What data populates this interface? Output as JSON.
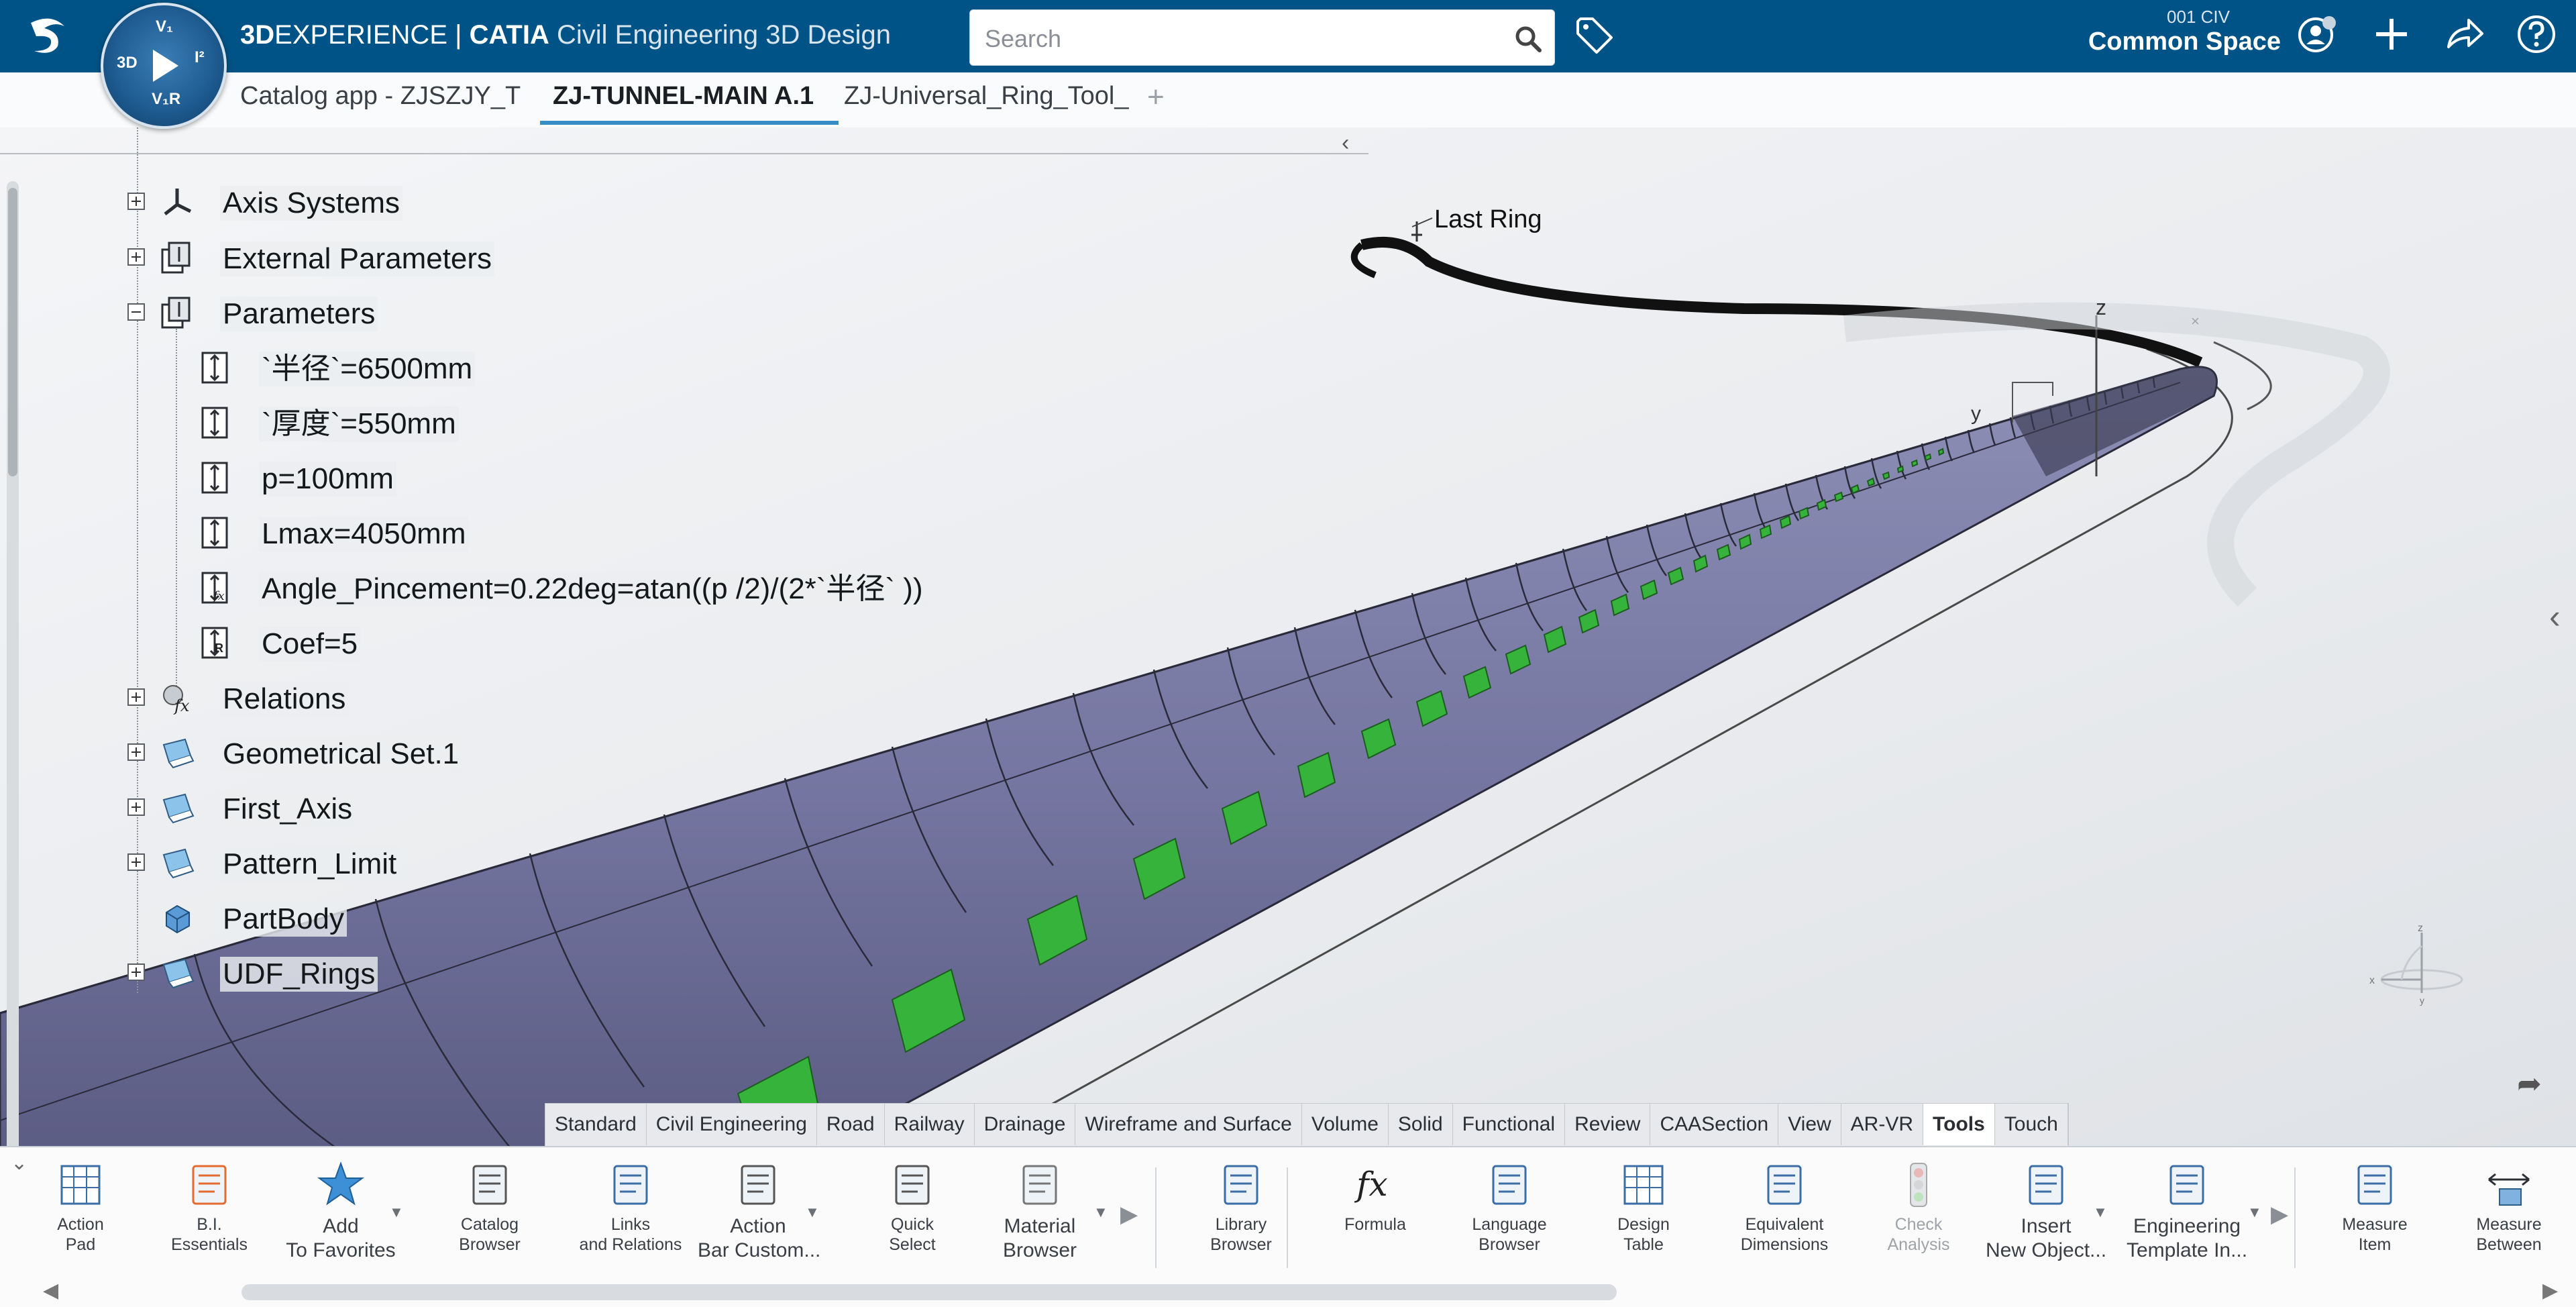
{
  "header": {
    "brand_3d": "3D",
    "brand_experience": "EXPERIENCE",
    "brand_separator": " | ",
    "brand_catia": "CATIA",
    "brand_app": " Civil Engineering 3D Design",
    "search_placeholder": "Search",
    "space_code": "001 CIV",
    "space_name": "Common Space",
    "compass_top": "V₁",
    "compass_left": "3D",
    "compass_right": "I²",
    "compass_bottom": "V₁R"
  },
  "tabs": [
    {
      "label": "Catalog app - ZJSZJY_T",
      "active": false
    },
    {
      "label": "ZJ-TUNNEL-MAIN A.1",
      "active": true
    },
    {
      "label": "ZJ-Universal_Ring_Tool_",
      "active": false
    }
  ],
  "tree": {
    "items": [
      {
        "label": "Axis Systems",
        "expand": "plus",
        "icon": "axis-system-icon"
      },
      {
        "label": "External Parameters",
        "expand": "plus",
        "icon": "external-parameters-icon"
      },
      {
        "label": "Parameters",
        "expand": "minus",
        "icon": "parameters-icon"
      },
      {
        "label": "`半径`=6500mm",
        "expand": "none",
        "icon": "length-parameter-icon"
      },
      {
        "label": "`厚度`=550mm",
        "expand": "none",
        "icon": "length-parameter-icon"
      },
      {
        "label": "p=100mm",
        "expand": "none",
        "icon": "length-parameter-icon"
      },
      {
        "label": "Lmax=4050mm",
        "expand": "none",
        "icon": "length-parameter-icon"
      },
      {
        "label": "Angle_Pincement=0.22deg=atan((p /2)/(2*`半径` ))",
        "expand": "none",
        "icon": "formula-parameter-icon"
      },
      {
        "label": "Coef=5",
        "expand": "none",
        "icon": "real-parameter-icon"
      },
      {
        "label": "Relations",
        "expand": "plus",
        "icon": "relations-icon"
      },
      {
        "label": "Geometrical Set.1",
        "expand": "plus",
        "icon": "geometrical-set-icon"
      },
      {
        "label": "First_Axis",
        "expand": "plus",
        "icon": "geometrical-set-icon"
      },
      {
        "label": "Pattern_Limit",
        "expand": "plus",
        "icon": "geometrical-set-icon"
      },
      {
        "label": "PartBody",
        "expand": "none",
        "icon": "part-body-icon"
      },
      {
        "label": "UDF_Rings",
        "expand": "plus",
        "icon": "geometrical-set-icon"
      }
    ]
  },
  "viewer": {
    "annotation": "Last Ring",
    "axis_z": "z",
    "axis_y": "y",
    "axis_x": "x",
    "colors": {
      "tunnel": "#7c7da3",
      "highlight": "#36b33a",
      "edge": "#2a2a3a"
    }
  },
  "workbench_tabs": [
    "Standard",
    "Civil Engineering",
    "Road",
    "Railway",
    "Drainage",
    "Wireframe and Surface",
    "Volume",
    "Solid",
    "Functional",
    "Review",
    "CAASection",
    "View",
    "AR-VR",
    "Tools",
    "Touch"
  ],
  "workbench_active": "Tools",
  "action_bar": [
    {
      "label1": "Action",
      "label2": "Pad",
      "icon": "action-pad-icon",
      "big": false
    },
    {
      "label1": "B.I.",
      "label2": "Essentials",
      "icon": "bi-essentials-icon",
      "big": false
    },
    {
      "label1": "Add",
      "label2": "To Favorites",
      "icon": "star-icon",
      "big": true
    },
    {
      "label1": "Catalog",
      "label2": "Browser",
      "icon": "catalog-browser-icon",
      "big": false
    },
    {
      "label1": "Links",
      "label2": "and Relations",
      "icon": "links-relations-icon",
      "big": false
    },
    {
      "label1": "Action",
      "label2": "Bar Custom...",
      "icon": "action-bar-customize-icon",
      "big": true
    },
    {
      "label1": "Quick",
      "label2": "Select",
      "icon": "quick-select-icon",
      "big": false
    },
    {
      "label1": "Material",
      "label2": "Browser",
      "icon": "material-browser-icon",
      "big": true
    },
    {
      "label1": "Library",
      "label2": "Browser",
      "icon": "library-browser-icon",
      "big": false
    },
    {
      "label1": "Formula",
      "label2": "",
      "icon": "formula-icon",
      "big": false
    },
    {
      "label1": "Language",
      "label2": "Browser",
      "icon": "language-browser-icon",
      "big": false
    },
    {
      "label1": "Design",
      "label2": "Table",
      "icon": "design-table-icon",
      "big": false
    },
    {
      "label1": "Equivalent",
      "label2": "Dimensions",
      "icon": "equivalent-dimensions-icon",
      "big": false
    },
    {
      "label1": "Check",
      "label2": "Analysis",
      "icon": "check-analysis-icon",
      "big": false,
      "disabled": true
    },
    {
      "label1": "Insert",
      "label2": "New Object...",
      "icon": "insert-new-object-icon",
      "big": true
    },
    {
      "label1": "Engineering",
      "label2": "Template In...",
      "icon": "engineering-template-icon",
      "big": true
    },
    {
      "label1": "Measure",
      "label2": "Item",
      "icon": "measure-item-icon",
      "big": false
    },
    {
      "label1": "Measure",
      "label2": "Between",
      "icon": "measure-between-icon",
      "big": false
    }
  ]
}
